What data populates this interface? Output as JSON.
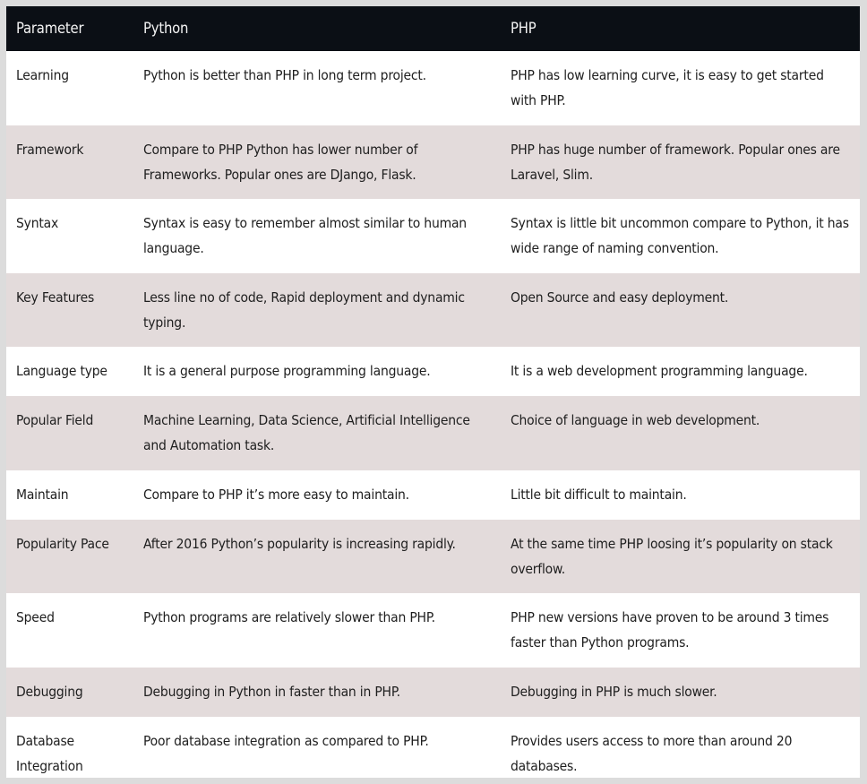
{
  "table": {
    "headers": [
      "Parameter",
      "Python",
      "PHP"
    ],
    "rows": [
      {
        "parameter": "Learning",
        "python": "Python is better than PHP in long term project.",
        "php": "PHP has low learning curve, it is easy to get started with PHP."
      },
      {
        "parameter": "Framework",
        "python": "Compare to PHP Python has lower number of Frameworks. Popular ones are DJango, Flask.",
        "php": "PHP has huge number of framework. Popular ones are Laravel, Slim."
      },
      {
        "parameter": "Syntax",
        "python": "Syntax is easy to remember almost similar to human language.",
        "php": "Syntax is little bit uncommon compare to Python, it has wide range of naming convention."
      },
      {
        "parameter": "Key Features",
        "python": "Less line no of code, Rapid deployment and dynamic typing.",
        "php": "Open Source and easy deployment."
      },
      {
        "parameter": "Language type",
        "python": "It is a general purpose programming language.",
        "php": "It is a web development programming language."
      },
      {
        "parameter": "Popular Field",
        "python": "Machine Learning, Data Science, Artificial Intelligence and Automation task.",
        "php": "Choice of language in web development."
      },
      {
        "parameter": "Maintain",
        "python": "Compare to PHP it’s more easy to maintain.",
        "php": "Little bit difficult to maintain."
      },
      {
        "parameter": "Popularity Pace",
        "python": "After 2016 Python’s popularity is increasing rapidly.",
        "php": "At the same time PHP loosing it’s popularity on stack overflow."
      },
      {
        "parameter": "Speed",
        "python": "Python programs are relatively slower than PHP.",
        "php": "PHP new versions have proven to be around 3 times faster than Python programs."
      },
      {
        "parameter": "Debugging",
        "python": "Debugging in Python in faster than in PHP.",
        "php": "Debugging in PHP is much slower."
      },
      {
        "parameter": "Database Integration",
        "python": "Poor database integration as compared to PHP.",
        "php": "Provides users access to more than around 20 databases."
      }
    ]
  },
  "colors": {
    "header_bg": "#0b0f15",
    "header_text": "#f4f4f4",
    "row_white": "#ffffff",
    "row_shaded": "#e3dbdb",
    "frame": "#dcdcdc"
  }
}
